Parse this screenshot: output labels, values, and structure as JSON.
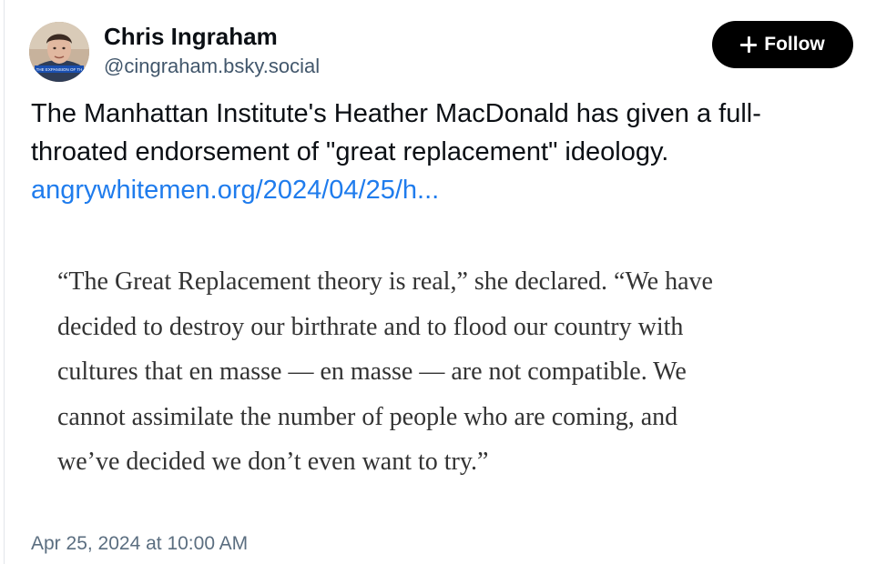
{
  "author": {
    "display_name": "Chris Ingraham",
    "handle": "@cingraham.bsky.social",
    "avatar_caption": "THE EXPANSION OF TH"
  },
  "follow_button": {
    "label": "Follow",
    "icon": "plus-icon"
  },
  "post": {
    "text_lines": [
      "The Manhattan Institute's Heather MacDonald has given a full-",
      "throated endorsement of \"great replacement\" ideology."
    ],
    "link_text": "angrywhitemen.org/2024/04/25/h...",
    "timestamp": "Apr 25, 2024 at 10:00 AM"
  },
  "quote_image": {
    "lines": [
      "“The Great Replacement theory is real,” she declared. “We have",
      "decided to destroy our birthrate and to flood our country with",
      "cultures that en masse — en masse — are not compatible. We",
      "cannot assimilate the number of people who are coming, and",
      "we’ve decided we don’t even want to try.”"
    ]
  },
  "colors": {
    "link": "#1f7ced",
    "follow_bg": "#000000",
    "handle": "#42576c",
    "timestamp": "#5b6e80",
    "quote_text": "#333333"
  }
}
